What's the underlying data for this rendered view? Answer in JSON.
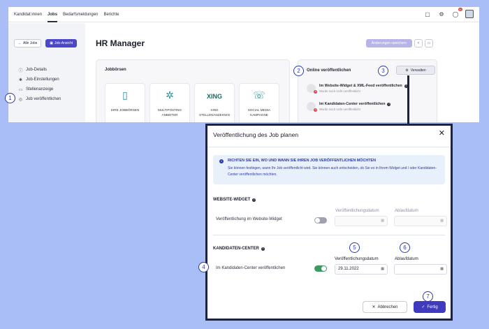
{
  "nav": {
    "items": [
      "Kandidat:innen",
      "Jobs",
      "Bedarfsmeldungen",
      "Berichte"
    ],
    "notification_count": "31"
  },
  "sidebar": {
    "back_label": "Alle Jobs",
    "job_view_label": "Job-Ansicht",
    "items": [
      "Job-Details",
      "Job-Einstellungen",
      "Stellenanzeige",
      "Job veröffentlichen"
    ]
  },
  "main": {
    "title": "HR Manager",
    "save_label": "Änderungen speichern"
  },
  "jobboards": {
    "title": "Jobbörsen",
    "tiles": [
      {
        "label": "IHRE JOBBÖRSEN",
        "icon": "document-icon"
      },
      {
        "label": "MULTIPOSTING ANBIETER",
        "icon": "network-icon"
      },
      {
        "label": "XING STELLENANZEIGEN",
        "icon": "xing-logo",
        "logo_text": "XING"
      },
      {
        "label": "SOCIAL MEDIA KAMPAGNE",
        "icon": "social-icon"
      }
    ]
  },
  "online": {
    "title": "Online veröffentlichen",
    "manage_label": "Verwalten",
    "rows": [
      {
        "title": "Im Website-Widget & XML-Feed veröffentlichen",
        "status": "Wurde noch nicht veröffentlicht"
      },
      {
        "title": "Im Kandidaten-Center veröffentlichen",
        "status": "Wurde noch nicht veröffentlicht"
      }
    ]
  },
  "steps": [
    "1",
    "2",
    "3",
    "4",
    "5",
    "6",
    "7"
  ],
  "modal": {
    "title": "Veröffentlichung des Job planen",
    "info_heading": "RICHTEN SIE EIN, WO UND WANN SIE IHREN JOB VERÖFFENTLICHEN MÖCHTEN",
    "info_body": "Sie können festlegen, wann Ihr Job veröffentlicht wird. Sie können auch entscheiden, ob Sie es in Ihrem Widget und / oder Kandidaten-Center veröffentlichen möchten.",
    "widget": {
      "section_title": "WEBSITE-WIDGET",
      "row_label": "Veröffentlichung im Website-Widget",
      "toggle_on": false,
      "date_label": "Veröffentlichungsdatum",
      "expiry_label": "Ablaufdatum",
      "date_value": "",
      "expiry_value": ""
    },
    "center": {
      "section_title": "KANDIDATEN-CENTER",
      "row_label": "Im Kandidaten-Center veröffentlichen",
      "toggle_on": true,
      "date_label": "Veröffentlichungsdatum",
      "expiry_label": "Ablaufdatum",
      "date_value": "29.11.2022",
      "expiry_value": ""
    },
    "cancel_label": "Abbrechen",
    "done_label": "Fertig"
  },
  "colors": {
    "background": "#a9bdf6",
    "primary": "#3f3ac0",
    "toggle_on": "#3a9a60",
    "frame": "#1b2242"
  }
}
